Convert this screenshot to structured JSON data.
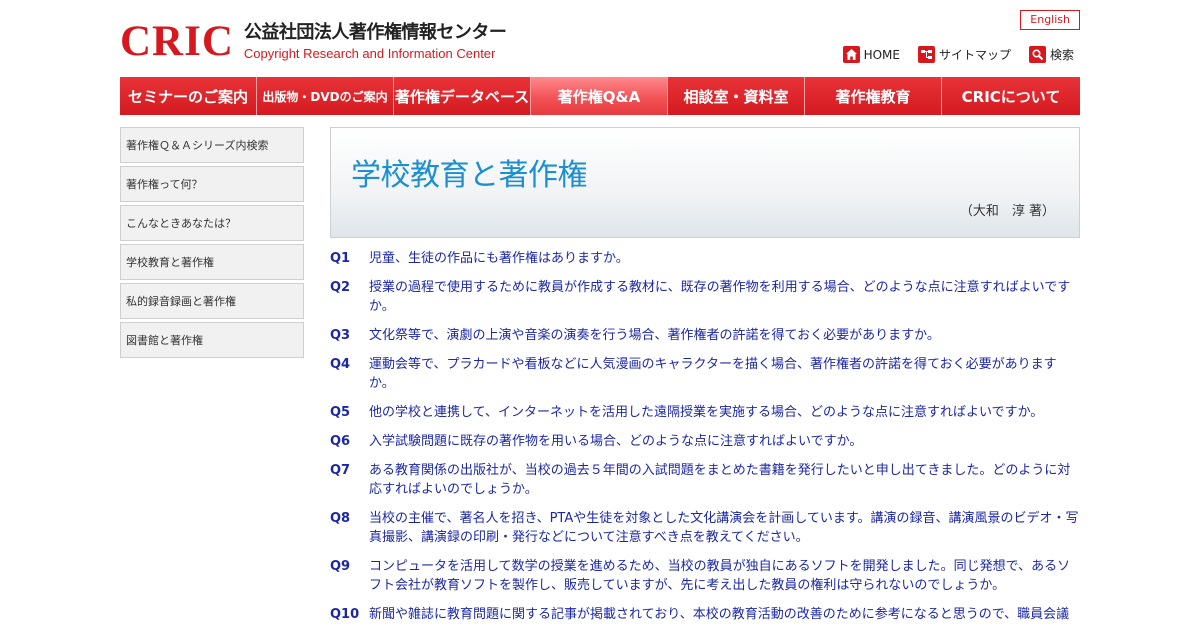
{
  "header": {
    "logo_mark": "CRIC",
    "logo_jp": "公益社団法人著作権情報センター",
    "logo_en": "Copyright Research and Information Center",
    "english_label": "English",
    "utility": [
      {
        "label": "HOME",
        "icon": "home-icon"
      },
      {
        "label": "サイトマップ",
        "icon": "sitemap-icon"
      },
      {
        "label": "検索",
        "icon": "search-icon"
      }
    ]
  },
  "nav": [
    {
      "label": "セミナーのご案内"
    },
    {
      "label": "出版物・DVDのご案内"
    },
    {
      "label": "著作権データベース"
    },
    {
      "label": "著作権Q&A"
    },
    {
      "label": "相談室・資料室"
    },
    {
      "label": "著作権教育"
    },
    {
      "label": "CRICについて"
    }
  ],
  "sidebar": [
    {
      "label": "著作権Ｑ＆Ａシリーズ内検索"
    },
    {
      "label": "著作権って何？"
    },
    {
      "label": "こんなときあなたは？"
    },
    {
      "label": "学校教育と著作権"
    },
    {
      "label": "私的録音録画と著作権"
    },
    {
      "label": "図書館と著作権"
    }
  ],
  "main": {
    "title": "学校教育と著作権",
    "author": "（大和　淳 著）",
    "questions": [
      {
        "num": "Q1",
        "text": "児童、生徒の作品にも著作権はありますか。"
      },
      {
        "num": "Q2",
        "text": "授業の過程で使用するために教員が作成する教材に、既存の著作物を利用する場合、どのような点に注意すればよいですか。"
      },
      {
        "num": "Q3",
        "text": "文化祭等で、演劇の上演や音楽の演奏を行う場合、著作権者の許諾を得ておく必要がありますか。"
      },
      {
        "num": "Q4",
        "text": "運動会等で、プラカードや看板などに人気漫画のキャラクターを描く場合、著作権者の許諾を得ておく必要がありますか。"
      },
      {
        "num": "Q5",
        "text": "他の学校と連携して、インターネットを活用した遠隔授業を実施する場合、どのような点に注意すればよいですか。"
      },
      {
        "num": "Q6",
        "text": "入学試験問題に既存の著作物を用いる場合、どのような点に注意すればよいですか。"
      },
      {
        "num": "Q7",
        "text": "ある教育関係の出版社が、当校の過去５年間の入試問題をまとめた書籍を発行したいと申し出てきました。どのように対応すればよいのでしょうか。"
      },
      {
        "num": "Q8",
        "text": "当校の主催で、著名人を招き、PTAや生徒を対象とした文化講演会を計画しています。講演の録音、講演風景のビデオ・写真撮影、講演録の印刷・発行などについて注意すべき点を教えてください。"
      },
      {
        "num": "Q9",
        "text": "コンピュータを活用して数学の授業を進めるため、当校の教員が独自にあるソフトを開発しました。同じ発想で、あるソフト会社が教育ソフトを製作し、販売していますが、先に考え出した教員の権利は守られないのでしょうか。"
      },
      {
        "num": "Q10",
        "text": "新聞や雑誌に教育問題に関する記事が掲載されており、本校の教育活動の改善のために参考になると思うので、職員会議"
      }
    ]
  },
  "colors": {
    "brand_red": "#d7191f",
    "link_blue": "#1c27a8",
    "title_blue": "#1b8fd0"
  }
}
